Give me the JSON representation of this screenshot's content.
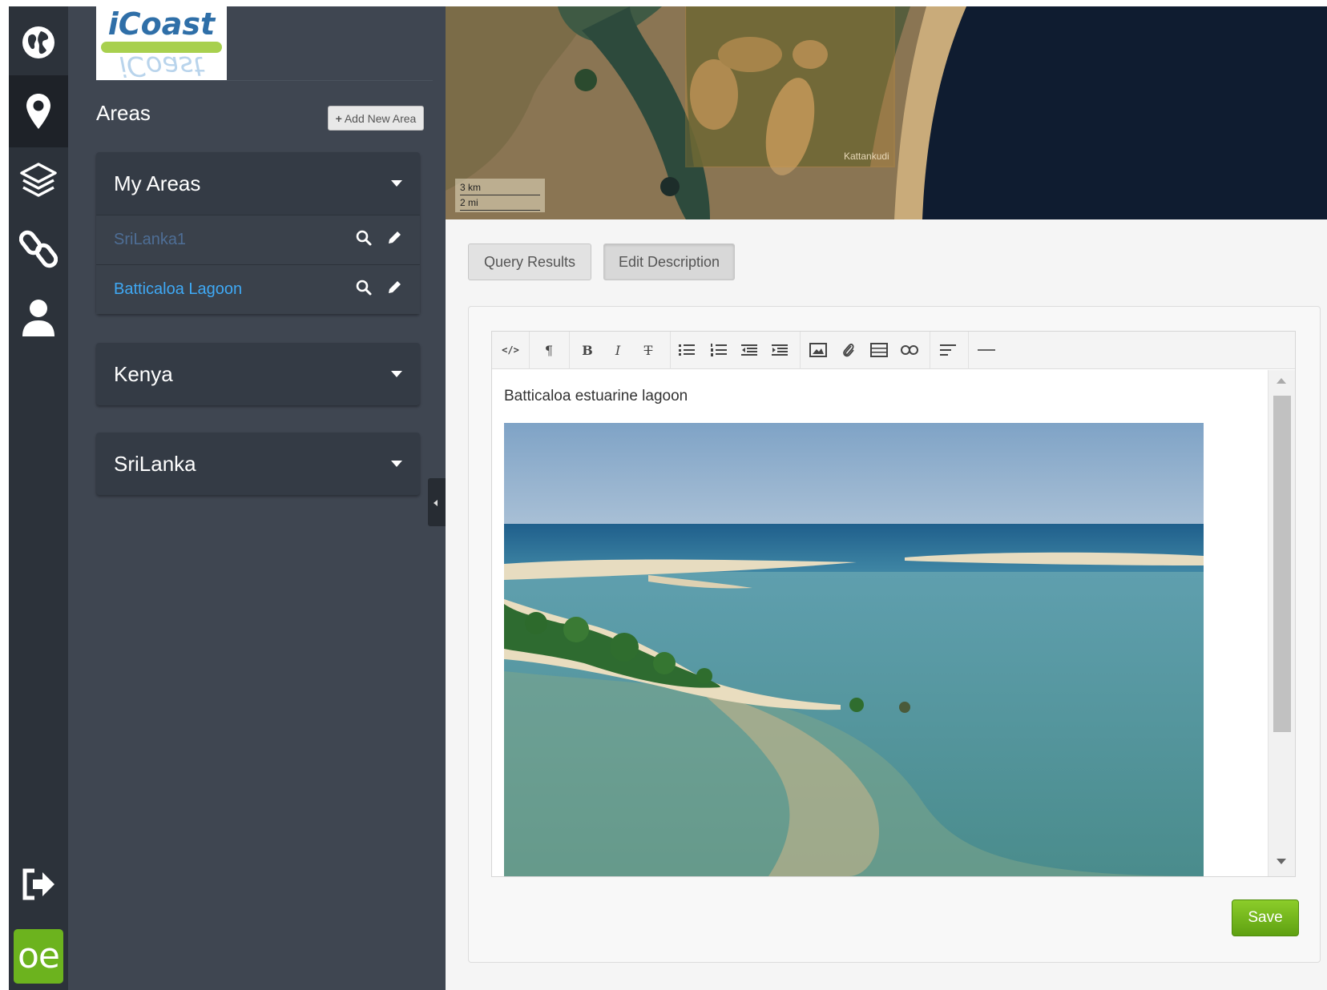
{
  "rail": {
    "items": [
      {
        "icon": "globe-icon",
        "active": false
      },
      {
        "icon": "map-marker-icon",
        "active": true
      },
      {
        "icon": "layers-icon",
        "active": false
      },
      {
        "icon": "chain-link-icon",
        "active": false
      },
      {
        "icon": "user-icon",
        "active": false
      }
    ],
    "logout_icon": "sign-out-icon",
    "badge": "oe",
    "badge_color": "#6cb31e"
  },
  "sidebar": {
    "logo": {
      "text": "iCoast",
      "reflection": "iCoast"
    },
    "title": "Areas",
    "add_button": "Add New Area",
    "groups": [
      {
        "name": "My Areas",
        "expanded": true,
        "areas": [
          {
            "name": "SriLanka1",
            "color": "#4e6e96"
          },
          {
            "name": "Batticaloa Lagoon",
            "color": "#3fa9f5"
          }
        ]
      },
      {
        "name": "Kenya",
        "expanded": false,
        "areas": []
      },
      {
        "name": "SriLanka",
        "expanded": false,
        "areas": []
      }
    ]
  },
  "map": {
    "scale_km": "3 km",
    "scale_mi": "2 mi",
    "place_label": "Kattankudi"
  },
  "content": {
    "tabs": [
      {
        "label": "Query Results",
        "active": false
      },
      {
        "label": "Edit Description",
        "active": true
      }
    ],
    "editor": {
      "toolbar": [
        "html",
        "formatting",
        "bold",
        "italic",
        "deleted",
        "unorderedlist",
        "orderedlist",
        "outdent",
        "indent",
        "image",
        "file",
        "table",
        "link",
        "alignment",
        "horizontalrule"
      ],
      "text": "Batticaloa estuarine lagoon",
      "image_alt": "lagoon photo"
    },
    "save_label": "Save",
    "save_color": "#6cb31e"
  }
}
